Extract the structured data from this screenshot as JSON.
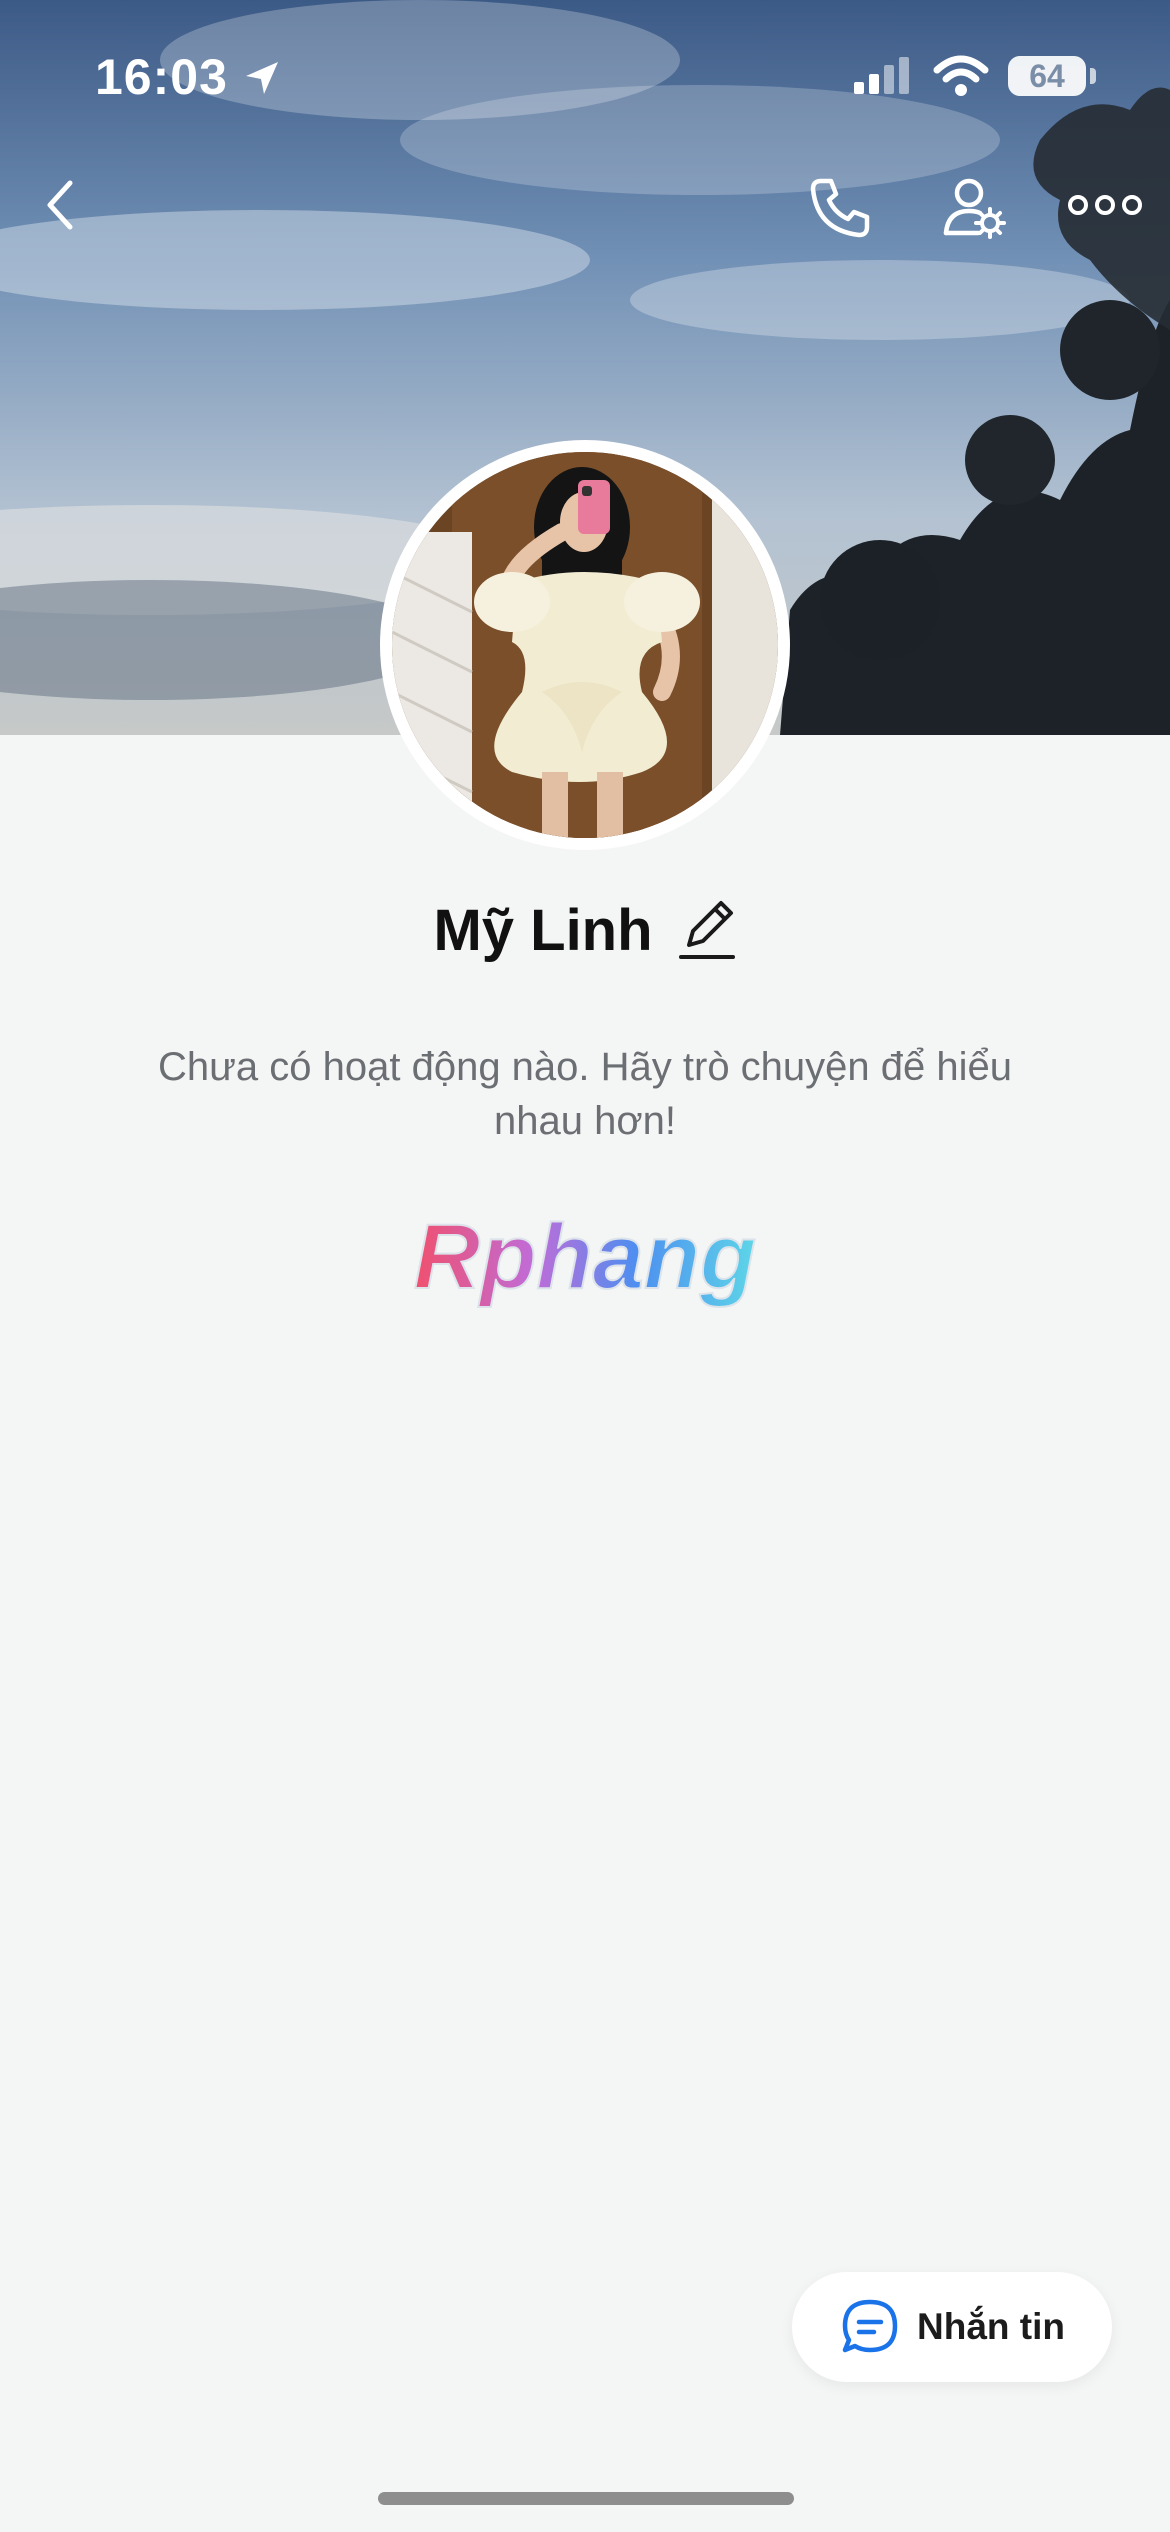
{
  "status_bar": {
    "time": "16:03",
    "battery": "64"
  },
  "header": {
    "icons": [
      "back-icon",
      "phone-icon",
      "user-settings-icon",
      "more-icon"
    ]
  },
  "profile": {
    "name": "Mỹ Linh",
    "activity_text": "Chưa có hoạt động nào. Hãy trò chuyện để hiểu nhau hơn!",
    "watermark": "Rphang"
  },
  "actions": {
    "message_label": "Nhắn tin"
  },
  "colors": {
    "accent": "#1a73e8",
    "background": "#f4f5f5"
  }
}
